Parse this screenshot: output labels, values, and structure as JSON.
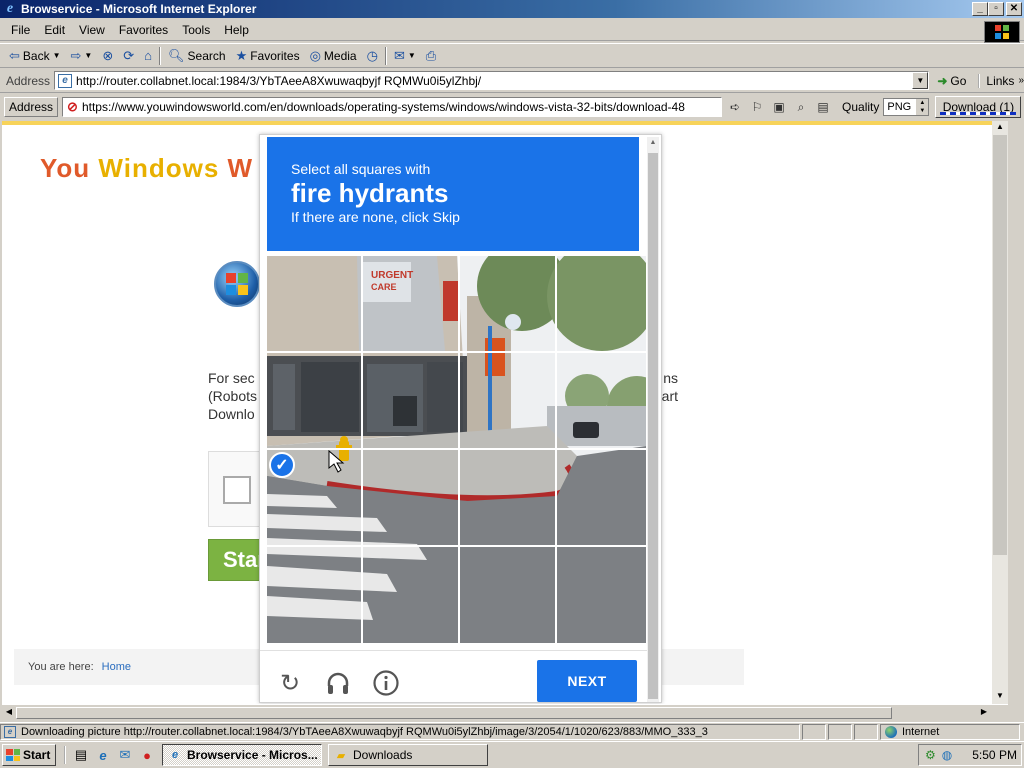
{
  "window": {
    "title": "Browservice - Microsoft Internet Explorer",
    "controls": {
      "minimize": "_",
      "maximize": "▫",
      "close": "✕"
    }
  },
  "menu": [
    "File",
    "Edit",
    "View",
    "Favorites",
    "Tools",
    "Help"
  ],
  "toolbar": {
    "back": "Back",
    "search": "Search",
    "favorites": "Favorites",
    "media": "Media"
  },
  "address_bar": {
    "label": "Address",
    "url": "http://router.collabnet.local:1984/3/YbTAeeA8Xwuwaqbyjf RQMWu0i5ylZhbj/",
    "go": "Go",
    "links": "Links"
  },
  "ext_bar": {
    "label": "Address",
    "url": "https://www.youwindowsworld.com/en/downloads/operating-systems/windows/windows-vista-32-bits/download-48",
    "quality_label": "Quality",
    "quality_value": "PNG",
    "download_label": "Download (1)"
  },
  "page": {
    "logo_part1": "You",
    "logo_part2": "Windows",
    "logo_part3": "W",
    "text_line1": "For sec",
    "text_line1_end": "ns",
    "text_line2": "(Robots",
    "text_line2_end": "art",
    "text_line3": "Downlo",
    "start_button": "Star",
    "breadcrumb_label": "You are here:",
    "breadcrumb_home": "Home"
  },
  "captcha": {
    "instruction_small": "Select all squares with",
    "instruction_target": "fire hydrants",
    "instruction_hint": "If there are none, click Skip",
    "rows": 4,
    "cols": 4,
    "selected_tiles": [
      [
        2,
        0
      ]
    ],
    "next_button": "NEXT",
    "icons": [
      "reload-icon",
      "audio-icon",
      "info-icon"
    ]
  },
  "status_bar": {
    "text": "Downloading picture http://router.collabnet.local:1984/3/YbTAeeA8Xwuwaqbyjf RQMWu0i5ylZhbj/image/3/2054/1/1020/623/883/MMO_333_3",
    "zone": "Internet"
  },
  "taskbar": {
    "start": "Start",
    "tasks": [
      {
        "label": "Browservice - Micros...",
        "active": true
      },
      {
        "label": "Downloads",
        "active": false
      }
    ],
    "clock": "5:50 PM"
  },
  "colors": {
    "titlebar": "#0a246a",
    "captcha_blue": "#1a73e8",
    "start_green": "#7cb342"
  }
}
